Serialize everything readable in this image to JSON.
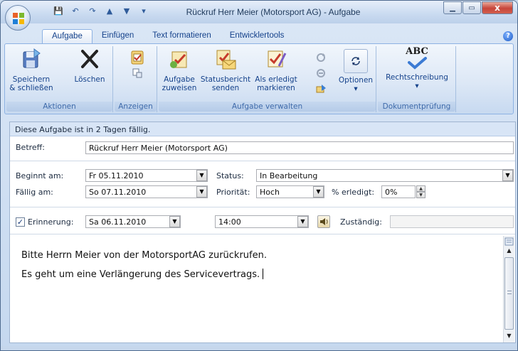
{
  "window": {
    "title": "Rückruf Herr Meier (Motorsport AG) - Aufgabe",
    "minimize_glyph": "▁",
    "maximize_glyph": "▭",
    "close_glyph": "x"
  },
  "qat_glyphs": [
    "💾",
    "↶",
    "↷",
    "▲",
    "▼",
    "▾"
  ],
  "help_glyph": "?",
  "ribbon": {
    "tabs": [
      {
        "label": "Aufgabe",
        "active": true
      },
      {
        "label": "Einfügen",
        "active": false
      },
      {
        "label": "Text formatieren",
        "active": false
      },
      {
        "label": "Entwicklertools",
        "active": false
      }
    ],
    "groups": {
      "aktionen": {
        "label": "Aktionen",
        "save_line1": "Speichern",
        "save_line2": "& schließen",
        "delete": "Löschen"
      },
      "anzeigen": {
        "label": "Anzeigen"
      },
      "aufgabe_verwalten": {
        "label": "Aufgabe verwalten",
        "assign_line1": "Aufgabe",
        "assign_line2": "zuweisen",
        "report_line1": "Statusbericht",
        "report_line2": "senden",
        "complete_line1": "Als erledigt",
        "complete_line2": "markieren",
        "options": "Optionen",
        "options_arrow": "▾"
      },
      "dokumentpruefung": {
        "label": "Dokumentprüfung",
        "spelling": "Rechtschreibung",
        "spelling_arrow": "▾",
        "abc": "ABC"
      }
    }
  },
  "form": {
    "notice": "Diese Aufgabe ist in 2 Tagen fällig.",
    "subject_label": "Betreff:",
    "subject_value": "Rückruf Herr Meier (Motorsport AG)",
    "start_label": "Beginnt am:",
    "start_value": "Fr 05.11.2010",
    "due_label": "Fällig am:",
    "due_value": "So 07.11.2010",
    "status_label": "Status:",
    "status_value": "In Bearbeitung",
    "priority_label": "Priorität:",
    "priority_value": "Hoch",
    "percent_label": "% erledigt:",
    "percent_value": "0%",
    "reminder_label": "Erinnerung:",
    "reminder_checked": true,
    "reminder_check_glyph": "✓",
    "reminder_date": "Sa 06.11.2010",
    "reminder_time": "14:00",
    "owner_label": "Zuständig:",
    "owner_value": "",
    "dropdown_glyph": "▼",
    "spin_up": "▲",
    "spin_down": "▼"
  },
  "body": {
    "line1": "Bitte Herrn Meier von der MotorsportAG zurückrufen.",
    "line2": "Es geht um eine Verlängerung des Servicevertrags.",
    "scroll_up": "▲",
    "scroll_down": "▼"
  },
  "colors": {
    "accent": "#15428b",
    "ribbon_border": "#8db2e3",
    "close": "#c7453a"
  }
}
